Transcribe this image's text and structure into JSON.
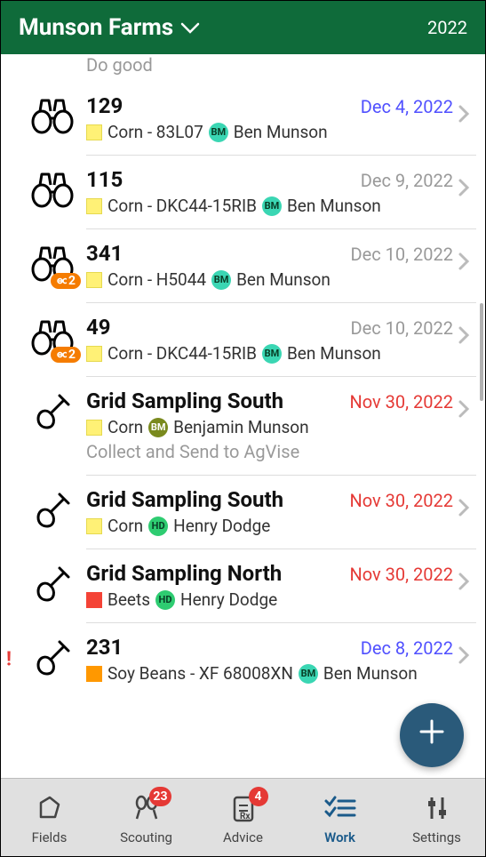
{
  "header": {
    "title": "Munson Farms",
    "year": "2022"
  },
  "top_note": "Do good",
  "items": [
    {
      "icon": "binoculars",
      "title": "129",
      "date": "Dec 4, 2022",
      "date_style": "blue",
      "swatch": "yellow",
      "crop": "Corn - 83L07",
      "avatar": "BM",
      "avatar_style": "teal",
      "person": "Ben Munson",
      "link_badge": null,
      "subnote": null,
      "alert": false
    },
    {
      "icon": "binoculars",
      "title": "115",
      "date": "Dec 9, 2022",
      "date_style": "gray",
      "swatch": "yellow",
      "crop": "Corn - DKC44-15RIB",
      "avatar": "BM",
      "avatar_style": "teal",
      "person": "Ben Munson",
      "link_badge": null,
      "subnote": null,
      "alert": false
    },
    {
      "icon": "binoculars",
      "title": "341",
      "date": "Dec 10, 2022",
      "date_style": "gray",
      "swatch": "yellow",
      "crop": "Corn - H5044",
      "avatar": "BM",
      "avatar_style": "teal",
      "person": "Ben Munson",
      "link_badge": "2",
      "subnote": null,
      "alert": false
    },
    {
      "icon": "binoculars",
      "title": "49",
      "date": "Dec 10, 2022",
      "date_style": "gray",
      "swatch": "yellow",
      "crop": "Corn - DKC44-15RIB",
      "avatar": "BM",
      "avatar_style": "teal",
      "person": "Ben Munson",
      "link_badge": "2",
      "subnote": null,
      "alert": false
    },
    {
      "icon": "shovel",
      "title": "Grid Sampling South",
      "date": "Nov 30, 2022",
      "date_style": "red",
      "swatch": "yellow",
      "crop": "Corn",
      "avatar": "BM",
      "avatar_style": "olive",
      "person": "Benjamin Munson",
      "link_badge": null,
      "subnote": "Collect and Send to AgVise",
      "alert": false
    },
    {
      "icon": "shovel",
      "title": "Grid Sampling South",
      "date": "Nov 30, 2022",
      "date_style": "red",
      "swatch": "yellow",
      "crop": "Corn",
      "avatar": "HD",
      "avatar_style": "green",
      "person": "Henry Dodge",
      "link_badge": null,
      "subnote": null,
      "alert": false
    },
    {
      "icon": "shovel",
      "title": "Grid Sampling North",
      "date": "Nov 30, 2022",
      "date_style": "red",
      "swatch": "red",
      "crop": "Beets",
      "avatar": "HD",
      "avatar_style": "green",
      "person": "Henry Dodge",
      "link_badge": null,
      "subnote": null,
      "alert": false
    },
    {
      "icon": "shovel",
      "title": "231",
      "date": "Dec 8, 2022",
      "date_style": "blue",
      "swatch": "orange",
      "crop": "Soy Beans - XF 68008XN",
      "avatar": "BM",
      "avatar_style": "teal",
      "person": "Ben Munson",
      "link_badge": null,
      "subnote": null,
      "alert": true
    }
  ],
  "tabs": {
    "fields": "Fields",
    "scouting": "Scouting",
    "scouting_badge": "23",
    "advice": "Advice",
    "advice_badge": "4",
    "work": "Work",
    "settings": "Settings"
  }
}
